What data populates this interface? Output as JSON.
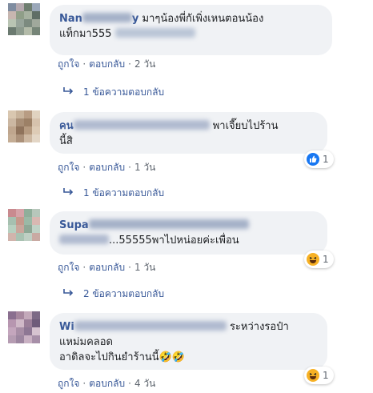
{
  "comments": [
    {
      "author": "Nan",
      "author_tail": "y",
      "text_line1": "มาๆน้องพี่กัเพิ่งเหนตอนน้อง",
      "text_line2": "แท็กมา555",
      "reply_label": "ถูกใจ",
      "reply_action": "ตอบกลับ",
      "time": "2 วัน",
      "replies": "1 ข้อความตอบกลับ",
      "avatar_colors": [
        "#7f8ca0",
        "#b4a8ae",
        "#6e7d6f",
        "#9aa7b9",
        "#c7b6b0",
        "#8f9e88",
        "#a6b1a0",
        "#5f6e66",
        "#b9c4b3",
        "#97a49a",
        "#7c8a7f",
        "#a0a89c",
        "#6b7a70",
        "#8c9a8d",
        "#b3bba9",
        "#768578"
      ]
    },
    {
      "author": "คน",
      "text_line1": "พาเจี๊ยบไปร้าน",
      "text_line2": "นี้สิ",
      "reply_label": "ถูกใจ",
      "reply_action": "ตอบกลับ",
      "time": "1 วัน",
      "replies": "1 ข้อความตอบกลับ",
      "reaction_count": "1",
      "avatar_colors": [
        "#d9c7b0",
        "#c8b39b",
        "#b89c83",
        "#e0d2c0",
        "#cbb7a2",
        "#a88e76",
        "#9c8066",
        "#d6c2ad",
        "#bfa68e",
        "#8f735c",
        "#b59a80",
        "#ddcbb6",
        "#c4ad95",
        "#ab917a",
        "#cdb8a2",
        "#e3d6c6"
      ]
    },
    {
      "author": "Supa",
      "text_line2": "...55555พาไปหน่อยค่ะเพื่อน",
      "reply_label": "ถูกใจ",
      "reply_action": "ตอบกลับ",
      "time": "1 วัน",
      "replies": "2 ข้อความตอบกลับ",
      "reaction_count": "1",
      "avatar_colors": [
        "#c98a8f",
        "#d6a3a8",
        "#8fae9a",
        "#b7c7bb",
        "#a6c0b0",
        "#c5998c",
        "#9ab9a6",
        "#d9b8b2",
        "#b7d0c0",
        "#caa69c",
        "#8ea896",
        "#c0d2c6",
        "#d1b4ac",
        "#a9c2b2",
        "#bfcfc4",
        "#c9aaa3"
      ]
    },
    {
      "author": "Wi",
      "text_line1": "ระหว่างรอป๋า",
      "text_line2": "แหม่มคลอด",
      "text_line3": "อาดิลจะไปกินยำร้านนี้🤣🤣",
      "reply_label": "ถูกใจ",
      "reply_action": "ตอบกลับ",
      "time": "4 วัน",
      "reaction_count": "1",
      "avatar_colors": [
        "#8a6f8f",
        "#a6879e",
        "#c3a9ba",
        "#7d6a86",
        "#b796b0",
        "#d0b9c8",
        "#9b7f99",
        "#6f5c7a",
        "#c4a6bd",
        "#a88ea6",
        "#8e7794",
        "#d6c3d0",
        "#b59cb2",
        "#9d86a0",
        "#c9b1c3",
        "#a78fa8"
      ]
    }
  ]
}
